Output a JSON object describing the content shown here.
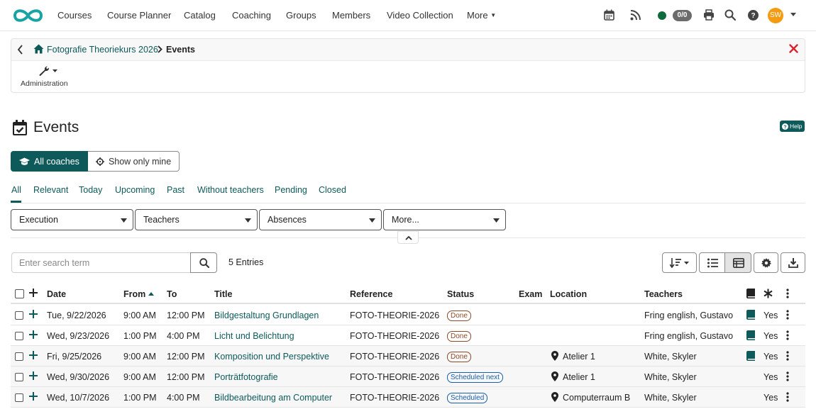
{
  "nav": {
    "items": [
      "Courses",
      "Course Planner",
      "Catalog",
      "Coaching",
      "Groups",
      "Members",
      "Video Collection",
      "More"
    ],
    "counter": "0/0",
    "avatar_initials": "SW",
    "icons": [
      "calendar-icon",
      "rss-icon",
      "online-status-icon",
      "print-icon",
      "search-icon",
      "help-icon",
      "user-avatar"
    ]
  },
  "breadcrumb": {
    "course": "Fotografie Theoriekurs 2026",
    "current": "Events"
  },
  "toolbar": {
    "admin_label": "Administration"
  },
  "page": {
    "title": "Events",
    "help_label": "Help"
  },
  "toggle": {
    "all_coaches": "All coaches",
    "show_only_mine": "Show only mine"
  },
  "tabs": [
    "All",
    "Relevant",
    "Today",
    "Upcoming",
    "Past",
    "Without teachers",
    "Pending",
    "Closed"
  ],
  "active_tab": "All",
  "filters": [
    "Execution",
    "Teachers",
    "Absences",
    "More..."
  ],
  "search": {
    "placeholder": "Enter search term",
    "entries": "5 Entries"
  },
  "table": {
    "headers": {
      "date": "Date",
      "from": "From",
      "to": "To",
      "title": "Title",
      "reference": "Reference",
      "status": "Status",
      "exam": "Exam",
      "location": "Location",
      "teachers": "Teachers"
    },
    "sort_column": "From",
    "sort_direction": "ascending",
    "rows": [
      {
        "date": "Tue, 9/22/2026",
        "from": "9:00 AM",
        "to": "12:00 PM",
        "title": "Bildgestaltung Grundlagen",
        "reference": "FOTO-THEORIE-2026",
        "status": "Done",
        "exam": "",
        "location": "",
        "teachers": "Fring english, Gustavo",
        "material": true,
        "required": "Yes"
      },
      {
        "date": "Wed, 9/23/2026",
        "from": "1:00 PM",
        "to": "4:00 PM",
        "title": "Licht und Belichtung",
        "reference": "FOTO-THEORIE-2026",
        "status": "Done",
        "exam": "",
        "location": "",
        "teachers": "Fring english, Gustavo",
        "material": true,
        "required": "Yes"
      },
      {
        "date": "Fri, 9/25/2026",
        "from": "9:00 AM",
        "to": "12:00 PM",
        "title": "Komposition und Perspektive",
        "reference": "FOTO-THEORIE-2026",
        "status": "Done",
        "exam": "",
        "location": "Atelier 1",
        "teachers": "White, Skyler",
        "material": true,
        "required": "Yes"
      },
      {
        "date": "Wed, 9/30/2026",
        "from": "9:00 AM",
        "to": "12:00 PM",
        "title": "Porträtfotografie",
        "reference": "FOTO-THEORIE-2026",
        "status": "Scheduled next",
        "exam": "",
        "location": "Atelier 1",
        "teachers": "White, Skyler",
        "material": false,
        "required": "Yes"
      },
      {
        "date": "Wed, 10/7/2026",
        "from": "1:00 PM",
        "to": "4:00 PM",
        "title": "Bildbearbeitung am Computer",
        "reference": "FOTO-THEORIE-2026",
        "status": "Scheduled",
        "exam": "",
        "location": "Computerraum B",
        "teachers": "White, Skyler",
        "material": false,
        "required": "Yes"
      }
    ]
  },
  "colors": {
    "brand": "#0e5a5a",
    "status_done": "#8a4b2a",
    "status_scheduled": "#1a5fa8",
    "close": "#d9232e",
    "avatar": "#f39c12",
    "online": "#0f6a3d"
  }
}
